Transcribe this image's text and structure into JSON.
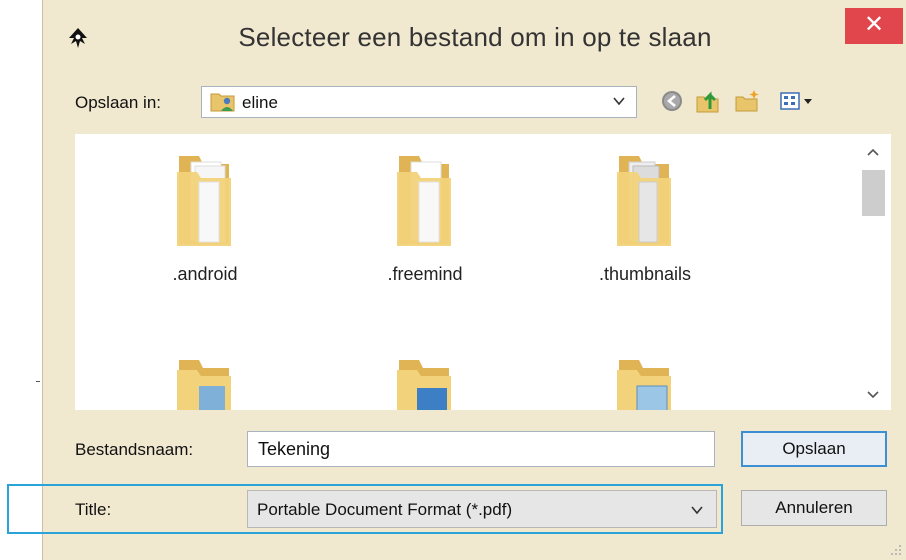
{
  "dialog": {
    "title": "Selecteer een bestand om in op te slaan",
    "close_glyph": "✕"
  },
  "lookin": {
    "label": "Opslaan in:",
    "value": "eline",
    "icon": "user-folder-icon"
  },
  "toolbar": {
    "icons": [
      "back-icon",
      "up-folder-icon",
      "new-folder-icon",
      "view-menu-icon"
    ]
  },
  "files": {
    "items": [
      {
        "label": ".android",
        "icon": "folder-icon"
      },
      {
        "label": ".freemind",
        "icon": "folder-icon"
      },
      {
        "label": ".thumbnails",
        "icon": "folder-icon"
      },
      {
        "label": "",
        "icon": "folder-icon"
      },
      {
        "label": "",
        "icon": "folder-icon"
      },
      {
        "label": "",
        "icon": "folder-icon"
      }
    ]
  },
  "filename": {
    "label": "Bestandsnaam:",
    "value": "Tekening"
  },
  "filetype": {
    "label": "Title:",
    "value": "Portable Document Format (*.pdf)"
  },
  "buttons": {
    "save": "Opslaan",
    "cancel": "Annuleren"
  },
  "colors": {
    "window_bg": "#f1e8d0",
    "close_bg": "#e0464c",
    "highlight": "#2aa3d8",
    "default_button_border": "#3c8fd4"
  }
}
